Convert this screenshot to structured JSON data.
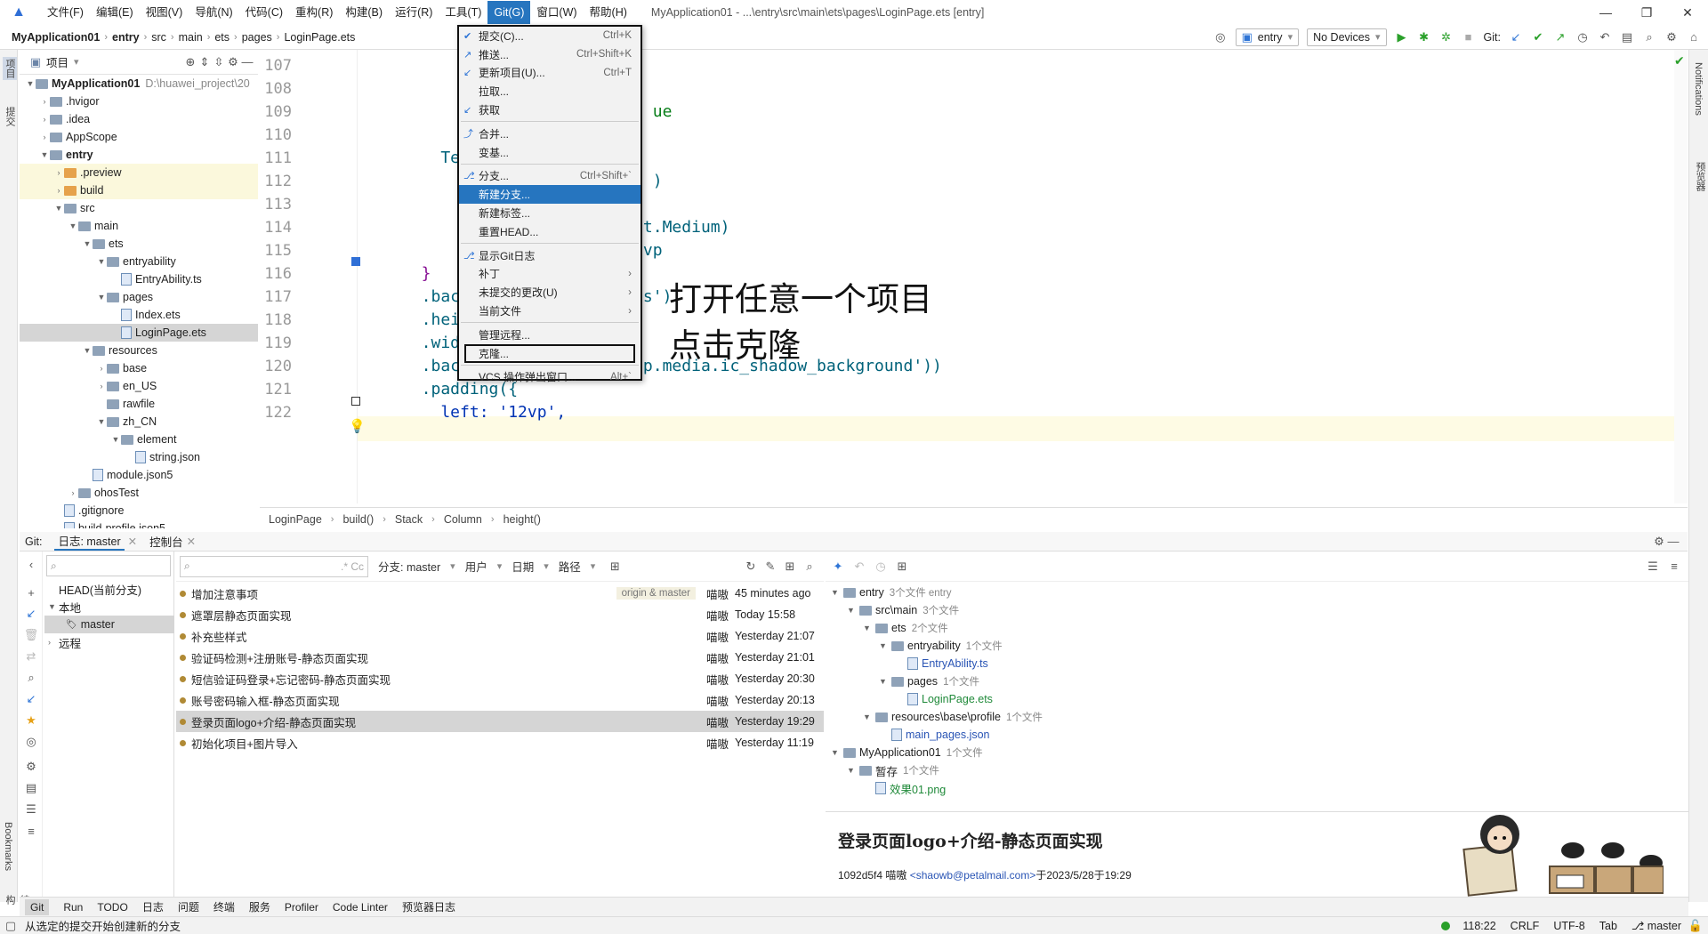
{
  "menubar": {
    "items": [
      "文件(F)",
      "编辑(E)",
      "视图(V)",
      "导航(N)",
      "代码(C)",
      "重构(R)",
      "构建(B)",
      "运行(R)",
      "工具(T)",
      "Git(G)",
      "窗口(W)",
      "帮助(H)"
    ],
    "active_index": 9,
    "window_title": "MyApplication01 - ...\\entry\\src\\main\\ets\\pages\\LoginPage.ets [entry]"
  },
  "navbar": {
    "crumbs": [
      "MyApplication01",
      "entry",
      "src",
      "main",
      "ets",
      "pages",
      "LoginPage.ets"
    ],
    "run_config": "entry",
    "device": "No Devices",
    "git_label": "Git:"
  },
  "project": {
    "header": "项目",
    "tree": [
      {
        "label": "MyApplication01",
        "hint": "D:\\huawei_project\\20",
        "indent": 0,
        "arrow": "▼",
        "kind": "folder",
        "bold": true
      },
      {
        "label": ".hvigor",
        "indent": 1,
        "arrow": "›",
        "kind": "folder"
      },
      {
        "label": ".idea",
        "indent": 1,
        "arrow": "›",
        "kind": "folder"
      },
      {
        "label": "AppScope",
        "indent": 1,
        "arrow": "›",
        "kind": "folder"
      },
      {
        "label": "entry",
        "indent": 1,
        "arrow": "▼",
        "kind": "folder",
        "bold": true
      },
      {
        "label": ".preview",
        "indent": 2,
        "arrow": "›",
        "kind": "folder-o",
        "hl": true
      },
      {
        "label": "build",
        "indent": 2,
        "arrow": "›",
        "kind": "folder-o",
        "hl": true
      },
      {
        "label": "src",
        "indent": 2,
        "arrow": "▼",
        "kind": "folder"
      },
      {
        "label": "main",
        "indent": 3,
        "arrow": "▼",
        "kind": "folder"
      },
      {
        "label": "ets",
        "indent": 4,
        "arrow": "▼",
        "kind": "folder"
      },
      {
        "label": "entryability",
        "indent": 5,
        "arrow": "▼",
        "kind": "folder"
      },
      {
        "label": "EntryAbility.ts",
        "indent": 6,
        "arrow": "",
        "kind": "file"
      },
      {
        "label": "pages",
        "indent": 5,
        "arrow": "▼",
        "kind": "folder"
      },
      {
        "label": "Index.ets",
        "indent": 6,
        "arrow": "",
        "kind": "file"
      },
      {
        "label": "LoginPage.ets",
        "indent": 6,
        "arrow": "",
        "kind": "file",
        "sel": true
      },
      {
        "label": "resources",
        "indent": 4,
        "arrow": "▼",
        "kind": "folder"
      },
      {
        "label": "base",
        "indent": 5,
        "arrow": "›",
        "kind": "folder"
      },
      {
        "label": "en_US",
        "indent": 5,
        "arrow": "›",
        "kind": "folder"
      },
      {
        "label": "rawfile",
        "indent": 5,
        "arrow": "",
        "kind": "folder"
      },
      {
        "label": "zh_CN",
        "indent": 5,
        "arrow": "▼",
        "kind": "folder"
      },
      {
        "label": "element",
        "indent": 6,
        "arrow": "▼",
        "kind": "folder"
      },
      {
        "label": "string.json",
        "indent": 7,
        "arrow": "",
        "kind": "file"
      },
      {
        "label": "module.json5",
        "indent": 4,
        "arrow": "",
        "kind": "file"
      },
      {
        "label": "ohosTest",
        "indent": 3,
        "arrow": "›",
        "kind": "folder"
      },
      {
        "label": ".gitignore",
        "indent": 2,
        "arrow": "",
        "kind": "file"
      },
      {
        "label": "build-profile.json5",
        "indent": 2,
        "arrow": "",
        "kind": "file"
      }
    ]
  },
  "editor": {
    "line_numbers": [
      "107",
      "108",
      "109",
      "110",
      "111",
      "112",
      "113",
      "114",
      "115",
      "116",
      "117",
      "118",
      "119",
      "120",
      "121",
      "122"
    ],
    "lines": [
      {
        "t": "      }",
        "c": "p"
      },
      {
        "t": "      .c",
        "c": "f"
      },
      {
        "t": "                          ue",
        "c": "s"
      },
      {
        "t": "      }",
        "c": "p"
      },
      {
        "t": "    Text",
        "c": "f"
      },
      {
        "t": "      .t                  )",
        "c": "f"
      },
      {
        "t": "      .t",
        "c": "f"
      },
      {
        "t": "      .f                nt.Medium)",
        "c": "f"
      },
      {
        "t": "      .m                0vp",
        "c": "f"
      },
      {
        "t": "  }",
        "c": "p"
      },
      {
        "t": "  .backg                 s')",
        "c": "f"
      },
      {
        "t": "  .height('100%')",
        "c": "f"
      },
      {
        "t": "  .width('100%')",
        "c": "f"
      },
      {
        "t": "  .backgroundImage($r('app.media.ic_shadow_background'))",
        "c": "f"
      },
      {
        "t": "  .padding({",
        "c": "f"
      },
      {
        "t": "    left: '12vp',",
        "c": "k"
      }
    ],
    "annotation_line1": "打开任意一个项目",
    "annotation_line2": "点击克隆",
    "breadcrumbs": [
      "LoginPage",
      "build()",
      "Stack",
      "Column",
      "height()"
    ]
  },
  "git_menu": {
    "items": [
      {
        "label": "提交(C)...",
        "shortcut": "Ctrl+K",
        "icon": "✔"
      },
      {
        "label": "推送...",
        "shortcut": "Ctrl+Shift+K",
        "icon": "↗"
      },
      {
        "label": "更新项目(U)...",
        "shortcut": "Ctrl+T",
        "icon": "↙"
      },
      {
        "label": "拉取...",
        "shortcut": "",
        "icon": ""
      },
      {
        "label": "获取",
        "shortcut": "",
        "icon": "↙"
      },
      {
        "sep": true
      },
      {
        "label": "合并...",
        "shortcut": "",
        "icon": "⤴"
      },
      {
        "label": "变基...",
        "shortcut": "",
        "icon": ""
      },
      {
        "sep": true
      },
      {
        "label": "分支...",
        "shortcut": "Ctrl+Shift+`",
        "icon": "⎇"
      },
      {
        "label": "新建分支...",
        "shortcut": "",
        "icon": "",
        "highlight": true
      },
      {
        "label": "新建标签...",
        "shortcut": "",
        "icon": ""
      },
      {
        "label": "重置HEAD...",
        "shortcut": "",
        "icon": ""
      },
      {
        "sep": true
      },
      {
        "label": "显示Git日志",
        "shortcut": "",
        "icon": "⎇"
      },
      {
        "label": "补丁",
        "shortcut": "›",
        "icon": ""
      },
      {
        "label": "未提交的更改(U)",
        "shortcut": "›",
        "icon": ""
      },
      {
        "label": "当前文件",
        "shortcut": "›",
        "icon": ""
      },
      {
        "sep": true
      },
      {
        "label": "管理远程...",
        "shortcut": "",
        "icon": ""
      },
      {
        "label": "克隆...",
        "shortcut": "",
        "icon": "",
        "boxed": true
      },
      {
        "sep": true
      },
      {
        "label": "VCS 操作弹出窗口...",
        "shortcut": "Alt+`",
        "icon": ""
      }
    ]
  },
  "git_panel": {
    "tabs": [
      "Git:",
      "日志: master",
      "控制台"
    ],
    "branches": [
      {
        "label": "HEAD(当前分支)",
        "indent": 0
      },
      {
        "label": "本地",
        "indent": 0,
        "arrow": "▼"
      },
      {
        "label": "master",
        "indent": 2,
        "sel": true
      },
      {
        "label": "远程",
        "indent": 0,
        "arrow": "›"
      }
    ],
    "filter_branch": "分支: master",
    "filter_user": "用户",
    "filter_date": "日期",
    "filter_path": "路径",
    "commits": [
      {
        "msg": "增加注意事项",
        "tag": "origin & master",
        "author": "喵嗷",
        "date": "45 minutes ago"
      },
      {
        "msg": "遮罩层静态页面实现",
        "author": "喵嗷",
        "date": "Today 15:58"
      },
      {
        "msg": "补充些样式",
        "author": "喵嗷",
        "date": "Yesterday 21:07"
      },
      {
        "msg": "验证码检测+注册账号-静态页面实现",
        "author": "喵嗷",
        "date": "Yesterday 21:01"
      },
      {
        "msg": "短信验证码登录+忘记密码-静态页面实现",
        "author": "喵嗷",
        "date": "Yesterday 20:30"
      },
      {
        "msg": "账号密码输入框-静态页面实现",
        "author": "喵嗷",
        "date": "Yesterday 20:13"
      },
      {
        "msg": "登录页面logo+介绍-静态页面实现",
        "author": "喵嗷",
        "date": "Yesterday 19:29",
        "sel": true
      },
      {
        "msg": "初始化项目+图片导入",
        "author": "喵嗷",
        "date": "Yesterday 11:19"
      }
    ],
    "changed_files": [
      {
        "label": "entry",
        "count": "3个文件 entry",
        "indent": 0,
        "arrow": "▼",
        "kind": "folder"
      },
      {
        "label": "src\\main",
        "count": "3个文件",
        "indent": 1,
        "arrow": "▼",
        "kind": "folder"
      },
      {
        "label": "ets",
        "count": "2个文件",
        "indent": 2,
        "arrow": "▼",
        "kind": "folder"
      },
      {
        "label": "entryability",
        "count": "1个文件",
        "indent": 3,
        "arrow": "▼",
        "kind": "folder"
      },
      {
        "label": "EntryAbility.ts",
        "count": "",
        "indent": 4,
        "arrow": "",
        "kind": "file",
        "color": "blu"
      },
      {
        "label": "pages",
        "count": "1个文件",
        "indent": 3,
        "arrow": "▼",
        "kind": "folder"
      },
      {
        "label": "LoginPage.ets",
        "count": "",
        "indent": 4,
        "arrow": "",
        "kind": "file",
        "color": "grn"
      },
      {
        "label": "resources\\base\\profile",
        "count": "1个文件",
        "indent": 2,
        "arrow": "▼",
        "kind": "folder"
      },
      {
        "label": "main_pages.json",
        "count": "",
        "indent": 3,
        "arrow": "",
        "kind": "file",
        "color": "blu"
      },
      {
        "label": "MyApplication01",
        "count": "1个文件",
        "indent": 0,
        "arrow": "▼",
        "kind": "folder"
      },
      {
        "label": "暂存",
        "count": "1个文件",
        "indent": 1,
        "arrow": "▼",
        "kind": "folder"
      },
      {
        "label": "效果01.png",
        "count": "",
        "indent": 2,
        "arrow": "",
        "kind": "file",
        "color": "grn"
      }
    ],
    "detail_title": "登录页面logo+介绍-静态页面实现",
    "detail_meta_prefix": "1092d5f4 喵嗷",
    "detail_email": "<shaowb@petalmail.com>",
    "detail_meta_suffix": "于2023/5/28于19:29"
  },
  "bottom_tabs": [
    "Git",
    "Run",
    "TODO",
    "日志",
    "问题",
    "终端",
    "服务",
    "Profiler",
    "Code Linter",
    "预览器日志"
  ],
  "statusbar": {
    "message": "从选定的提交开始创建新的分支",
    "position": "118:22",
    "line_ending": "CRLF",
    "encoding": "UTF-8",
    "indent": "Tab",
    "branch": "master"
  },
  "side_labels": {
    "left_project": "项目",
    "left_commit": "提交",
    "left_bookmarks": "Bookmarks",
    "left_structure": "结构",
    "right_notifications": "Notifications",
    "right_previewer": "预览器"
  },
  "colors": {
    "accent": "#2675bf",
    "selection": "#d5d5d5",
    "current_line": "#fefbe4"
  }
}
